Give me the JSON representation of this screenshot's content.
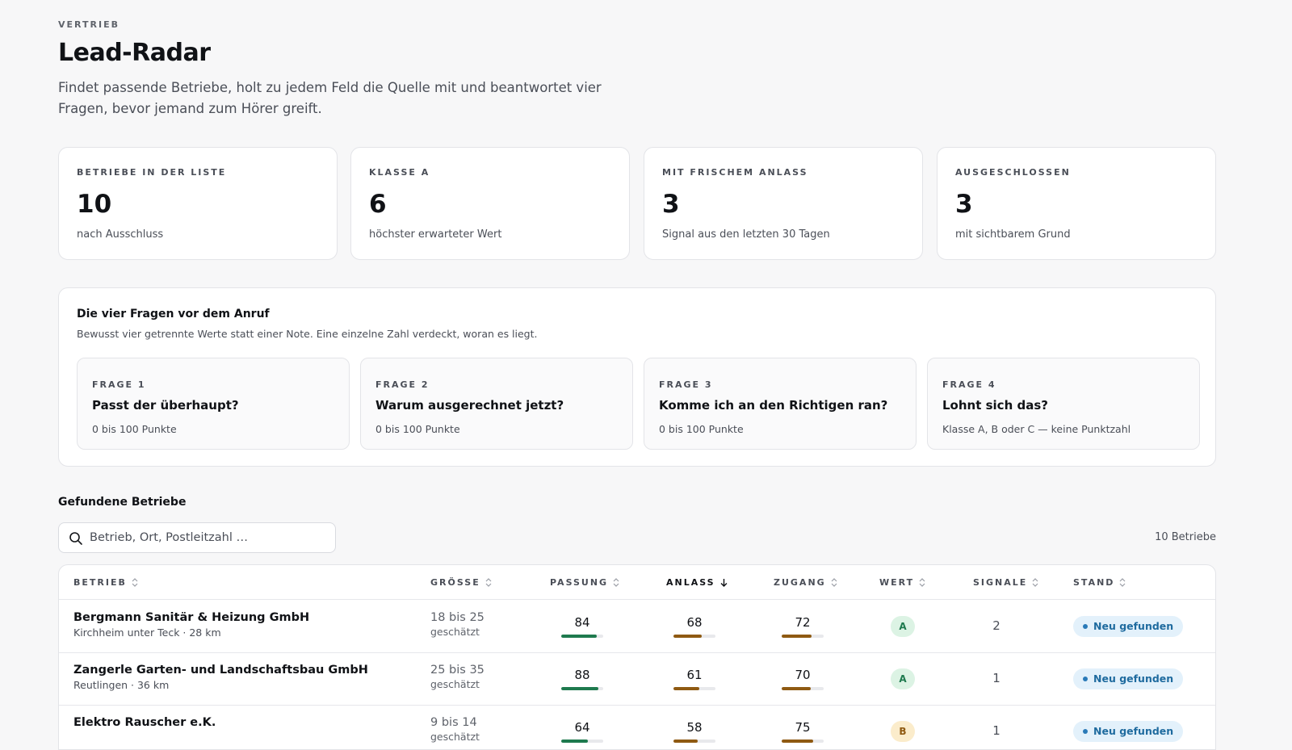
{
  "header": {
    "eyebrow": "VERTRIEB",
    "title": "Lead-Radar",
    "subtitle": "Findet passende Betriebe, holt zu jedem Feld die Quelle mit und beantwortet vier Fragen, bevor jemand zum Hörer greift."
  },
  "kpis": [
    {
      "label": "BETRIEBE IN DER LISTE",
      "value": "10",
      "note": "nach Ausschluss"
    },
    {
      "label": "KLASSE A",
      "value": "6",
      "note": "höchster erwarteter Wert"
    },
    {
      "label": "MIT FRISCHEM ANLASS",
      "value": "3",
      "note": "Signal aus den letzten 30 Tagen"
    },
    {
      "label": "AUSGESCHLOSSEN",
      "value": "3",
      "note": "mit sichtbarem Grund"
    }
  ],
  "questions": {
    "title": "Die vier Fragen vor dem Anruf",
    "subtitle": "Bewusst vier getrennte Werte statt einer Note. Eine einzelne Zahl verdeckt, woran es liegt.",
    "items": [
      {
        "eyebrow": "FRAGE 1",
        "question": "Passt der überhaupt?",
        "scale": "0 bis 100 Punkte"
      },
      {
        "eyebrow": "FRAGE 2",
        "question": "Warum ausgerechnet jetzt?",
        "scale": "0 bis 100 Punkte"
      },
      {
        "eyebrow": "FRAGE 3",
        "question": "Komme ich an den Richtigen ran?",
        "scale": "0 bis 100 Punkte"
      },
      {
        "eyebrow": "FRAGE 4",
        "question": "Lohnt sich das?",
        "scale": "Klasse A, B oder C — keine Punktzahl"
      }
    ]
  },
  "list": {
    "title": "Gefundene Betriebe",
    "search_placeholder": "Betrieb, Ort, Postleitzahl …",
    "count": "10 Betriebe"
  },
  "table": {
    "columns": [
      "BETRIEB",
      "GRÖSSE",
      "PASSUNG",
      "ANLASS",
      "ZUGANG",
      "WERT",
      "SIGNALE",
      "STAND"
    ],
    "sorted_column": "ANLASS",
    "rows": [
      {
        "name": "Bergmann Sanitär & Heizung GmbH",
        "meta": "Kirchheim unter Teck · 28 km",
        "size": "18 bis 25",
        "size_note": "geschätzt",
        "fit": "84",
        "trigger": "68",
        "access": "72",
        "grade": "A",
        "signals": "2",
        "status": "Neu gefunden"
      },
      {
        "name": "Zangerle Garten- und Landschaftsbau GmbH",
        "meta": "Reutlingen · 36 km",
        "size": "25 bis 35",
        "size_note": "geschätzt",
        "fit": "88",
        "trigger": "61",
        "access": "70",
        "grade": "A",
        "signals": "1",
        "status": "Neu gefunden"
      },
      {
        "name": "Elektro Rauscher e.K.",
        "meta": "",
        "size": "9 bis 14",
        "size_note": "geschätzt",
        "fit": "64",
        "trigger": "58",
        "access": "75",
        "grade": "B",
        "signals": "1",
        "status": "Neu gefunden"
      }
    ]
  },
  "colors": {
    "fit_bar": "#1e7a4e",
    "trigger_bar": "#8f5a12",
    "access_bar": "#8f5a12",
    "grade_a_bg": "#dcf3e4",
    "grade_a_fg": "#1e7a4e",
    "grade_b_bg": "#fbeccb",
    "grade_b_fg": "#8f5a12"
  },
  "icons": {
    "search": "search-icon",
    "sort": "sort-updown-icon",
    "sort_active": "arrow-down-icon"
  }
}
